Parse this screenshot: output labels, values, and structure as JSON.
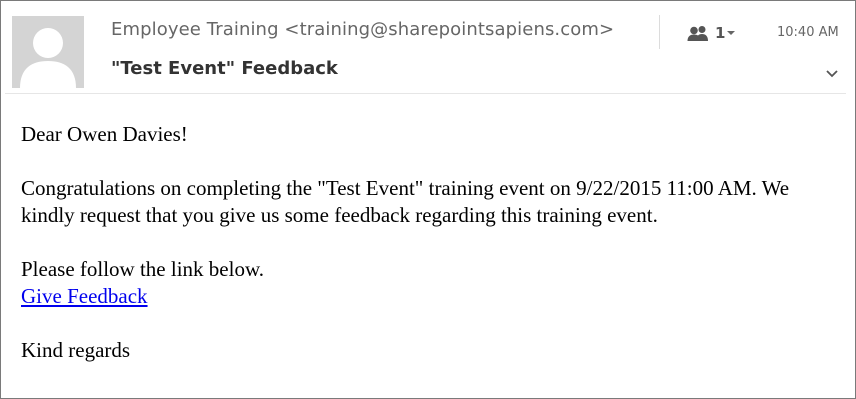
{
  "header": {
    "sender": "Employee Training <training@sharepointsapiens.com>",
    "subject": "\"Test Event\" Feedback",
    "recipients_count": "1",
    "time": "10:40 AM",
    "icons": {
      "avatar": "person-silhouette",
      "people": "people-icon",
      "expand": "chevron-down-icon"
    }
  },
  "body": {
    "greeting": "Dear Owen Davies!",
    "paragraph": "Congratulations on completing the \"Test Event\" training event on 9/22/2015 11:00 AM. We kindly request that you give us some feedback regarding this training event.",
    "follow_text": "Please follow the link below.",
    "link_text": "Give Feedback",
    "closing": "Kind regards"
  },
  "colors": {
    "link": "#0000ee",
    "header_text": "#666666",
    "subject_text": "#333333",
    "avatar_bg": "#d4d4d4"
  }
}
